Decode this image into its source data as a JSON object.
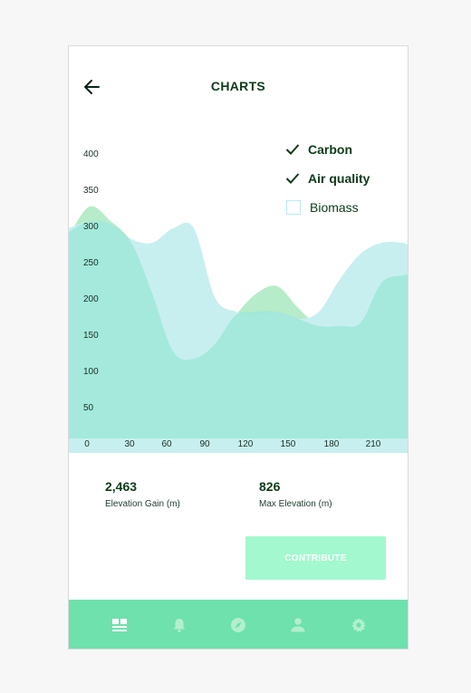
{
  "header": {
    "title": "CHARTS",
    "back_icon": "arrow-left-icon"
  },
  "legend": [
    {
      "label": "Carbon",
      "checked": true,
      "color": "#b6ecc9"
    },
    {
      "label": "Air quality",
      "checked": true,
      "color": "#c8eff0"
    },
    {
      "label": "Biomass",
      "checked": false,
      "color": "#9ee7d8"
    }
  ],
  "chart_data": {
    "type": "area",
    "x_ticks": [
      "0",
      "30",
      "60",
      "90",
      "120",
      "150",
      "180",
      "210"
    ],
    "y_ticks": [
      "400",
      "350",
      "300",
      "250",
      "200",
      "150",
      "100",
      "50"
    ],
    "xlim": [
      0,
      245
    ],
    "ylim": [
      0,
      430
    ],
    "series": [
      {
        "name": "Carbon",
        "color": "#b6ecc9",
        "x": [
          0,
          15,
          30,
          45,
          60,
          75,
          90,
          105,
          120,
          135,
          150,
          165,
          180,
          195,
          210,
          225,
          240,
          245
        ],
        "y": [
          280,
          320,
          300,
          270,
          200,
          120,
          110,
          130,
          170,
          200,
          210,
          180,
          155,
          155,
          160,
          215,
          225,
          225
        ]
      },
      {
        "name": "Air quality",
        "color": "#c8eff0",
        "x": [
          0,
          15,
          30,
          45,
          60,
          75,
          90,
          105,
          120,
          135,
          150,
          165,
          180,
          195,
          210,
          225,
          240,
          245
        ],
        "y": [
          290,
          300,
          295,
          275,
          270,
          290,
          290,
          195,
          175,
          170,
          175,
          165,
          175,
          220,
          255,
          270,
          270,
          265
        ]
      },
      {
        "name": "Biomass",
        "color": "#9ee7d8",
        "x": [
          0,
          15,
          30,
          45,
          60,
          75,
          90,
          105,
          120,
          135,
          150,
          165,
          180,
          195,
          210,
          225,
          240,
          245
        ],
        "y": [
          285,
          300,
          295,
          270,
          200,
          120,
          110,
          130,
          170,
          175,
          175,
          165,
          155,
          155,
          160,
          215,
          225,
          225
        ]
      }
    ],
    "grid": false,
    "legend_position": "top-right"
  },
  "stats": [
    {
      "value": "2,463",
      "label": "Elevation Gain (m)"
    },
    {
      "value": "826",
      "label": "Max Elevation (m)"
    }
  ],
  "actions": {
    "contribute_label": "CONTRIBUTE"
  },
  "bottom_nav": {
    "items": [
      {
        "icon": "dashboard-icon",
        "active": true
      },
      {
        "icon": "bell-icon",
        "active": false
      },
      {
        "icon": "compass-icon",
        "active": false
      },
      {
        "icon": "person-icon",
        "active": false
      },
      {
        "icon": "gear-icon",
        "active": false
      }
    ]
  },
  "colors": {
    "accent": "#6ee1ac",
    "button": "#a3f8cf",
    "text_dark": "#0d3b1a"
  }
}
